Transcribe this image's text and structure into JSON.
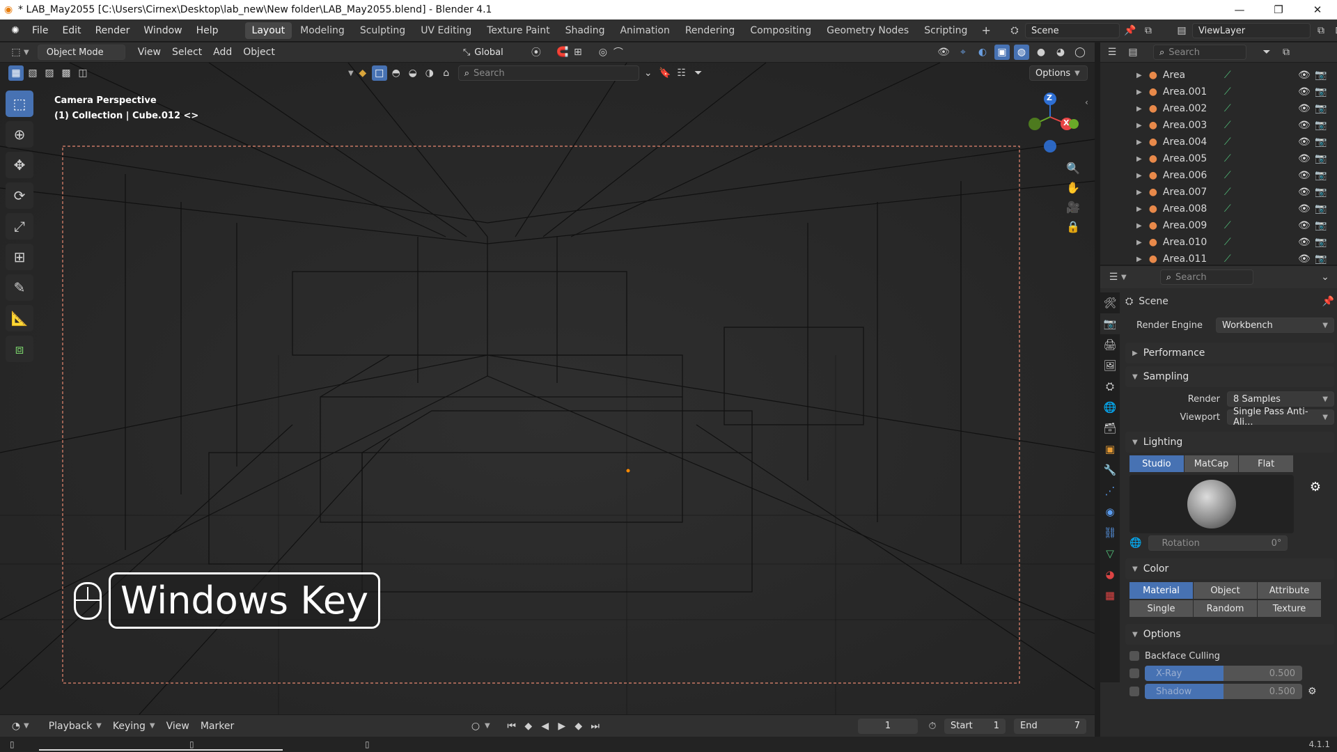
{
  "window": {
    "title": "* LAB_May2055 [C:\\Users\\Cirnex\\Desktop\\lab_new\\New folder\\LAB_May2055.blend] - Blender 4.1",
    "min": "—",
    "max": "❐",
    "close": "✕"
  },
  "menu": [
    "File",
    "Edit",
    "Render",
    "Window",
    "Help"
  ],
  "workspaces": [
    "Layout",
    "Modeling",
    "Sculpting",
    "UV Editing",
    "Texture Paint",
    "Shading",
    "Animation",
    "Rendering",
    "Compositing",
    "Geometry Nodes",
    "Scripting"
  ],
  "active_workspace": "Layout",
  "add_workspace": "+",
  "scene_field": "Scene",
  "viewlayer_field": "ViewLayer",
  "viewport_header": {
    "mode": "Object Mode",
    "view": "View",
    "select": "Select",
    "add": "Add",
    "object": "Object",
    "orientation": "Global",
    "search_placeholder": "Search",
    "options": "Options"
  },
  "viewport_overlay": {
    "line1": "Camera Perspective",
    "line2": "(1) Collection | Cube.012 <>"
  },
  "key_overlay": {
    "label": "Windows Key"
  },
  "gizmo": {
    "z": "Z",
    "x": "X"
  },
  "outliner": {
    "search_placeholder": "Search",
    "items": [
      "Area",
      "Area.001",
      "Area.002",
      "Area.003",
      "Area.004",
      "Area.005",
      "Area.006",
      "Area.007",
      "Area.008",
      "Area.009",
      "Area.010",
      "Area.011"
    ]
  },
  "properties": {
    "search_placeholder": "Search",
    "context": "Scene",
    "render_engine_label": "Render Engine",
    "render_engine": "Workbench",
    "panels": {
      "performance": "Performance",
      "sampling": "Sampling",
      "lighting": "Lighting",
      "color": "Color",
      "options": "Options"
    },
    "sampling": {
      "render_label": "Render",
      "render_value": "8 Samples",
      "viewport_label": "Viewport",
      "viewport_value": "Single Pass Anti-Ali..."
    },
    "lighting_modes": [
      "Studio",
      "MatCap",
      "Flat"
    ],
    "lighting_active": "Studio",
    "rotation_label": "Rotation",
    "rotation_value": "0°",
    "color_modes": [
      "Material",
      "Object",
      "Attribute",
      "Single",
      "Random",
      "Texture"
    ],
    "color_active": "Material",
    "backface_culling": "Backface Culling",
    "xray_label": "X-Ray",
    "xray_value": "0.500",
    "xray_fraction": 0.5,
    "shadow_label": "Shadow",
    "shadow_value": "0.500",
    "shadow_fraction": 0.5
  },
  "timeline": {
    "playback": "Playback",
    "keying": "Keying",
    "view": "View",
    "marker": "Marker",
    "current_frame": "1",
    "start_label": "Start",
    "start": "1",
    "end_label": "End",
    "end": "7"
  },
  "status": {
    "version": "4.1.1"
  },
  "colors": {
    "accent": "#4772b3",
    "x_axis": "#e84545",
    "y_axis": "#6aaa28",
    "z_axis": "#2e6fd4",
    "camera_frame": "#e88870"
  }
}
